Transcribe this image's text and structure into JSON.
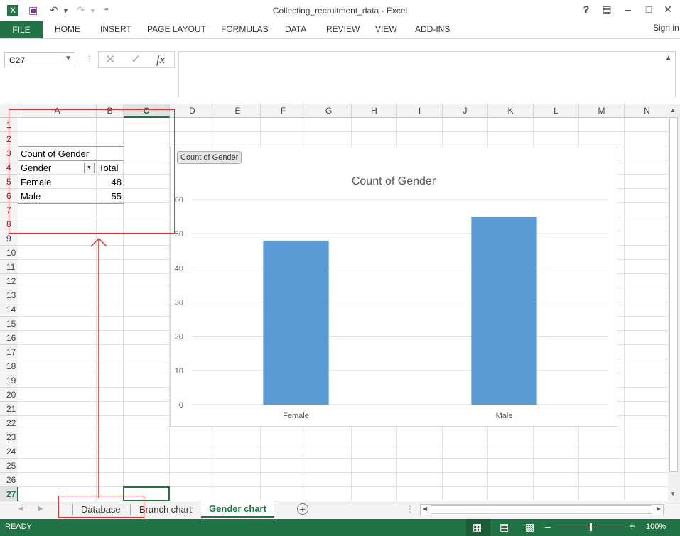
{
  "window": {
    "title": "Collecting_recruitment_data - Excel",
    "help": "?",
    "sign_in": "Sign in"
  },
  "ribbon": {
    "tabs": [
      "FILE",
      "HOME",
      "INSERT",
      "PAGE LAYOUT",
      "FORMULAS",
      "DATA",
      "REVIEW",
      "VIEW",
      "ADD-INS"
    ]
  },
  "formula_bar": {
    "name_box": "C27",
    "fx_label": "fx",
    "content": ""
  },
  "grid": {
    "columns": [
      "A",
      "B",
      "C",
      "D",
      "E",
      "F",
      "G",
      "H",
      "I",
      "J",
      "K",
      "L",
      "M",
      "N"
    ],
    "rows": [
      "1",
      "2",
      "3",
      "4",
      "5",
      "6",
      "7",
      "8",
      "9",
      "10",
      "11",
      "12",
      "13",
      "14",
      "15",
      "16",
      "17",
      "18",
      "19",
      "20",
      "21",
      "22",
      "23",
      "24",
      "25",
      "26",
      "27"
    ],
    "selected_cell": "C27"
  },
  "pivot_table": {
    "title": "Count of Gender",
    "header_field": "Gender",
    "header_value": "Total",
    "rows": [
      {
        "label": "Female",
        "value": "48"
      },
      {
        "label": "Male",
        "value": "55"
      }
    ]
  },
  "chart_field_button": "Count of Gender",
  "chart_data": {
    "type": "bar",
    "title": "Count of Gender",
    "categories": [
      "Female",
      "Male"
    ],
    "values": [
      48,
      55
    ],
    "ylim": [
      0,
      60
    ],
    "yticks": [
      "0",
      "10",
      "20",
      "30",
      "40",
      "50",
      "60"
    ],
    "grid": true,
    "bar_color": "#5b9bd5"
  },
  "sheet_tabs": {
    "tabs": [
      "Database",
      "Branch chart",
      "Gender chart"
    ],
    "active": "Gender chart"
  },
  "status": {
    "ready": "READY",
    "zoom": "100%"
  },
  "colors": {
    "excel_green": "#217346",
    "annotation_red": "#e8302f"
  }
}
